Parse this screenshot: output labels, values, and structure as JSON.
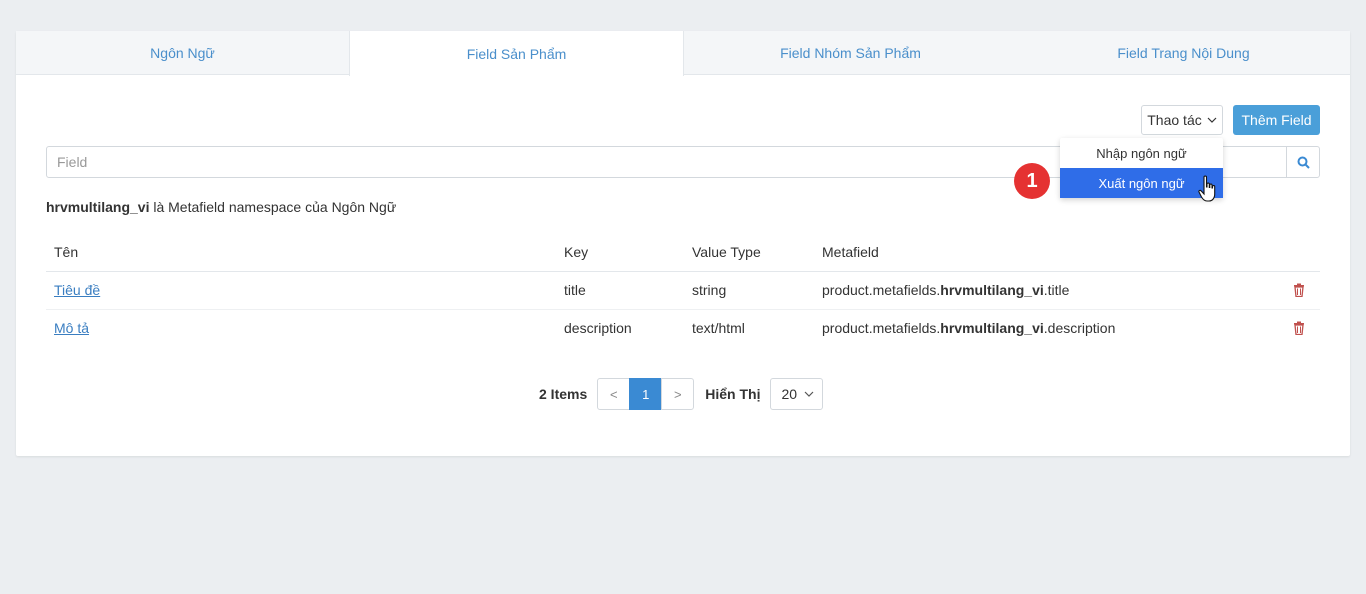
{
  "tabs": [
    {
      "label": "Ngôn Ngữ",
      "active": false
    },
    {
      "label": "Field Sản Phẩm",
      "active": true
    },
    {
      "label": "Field Nhóm Sản Phẩm",
      "active": false
    },
    {
      "label": "Field Trang Nội Dung",
      "active": false
    }
  ],
  "toolbar": {
    "actions_label": "Thao tác",
    "add_label": "Thêm Field"
  },
  "search": {
    "placeholder": "Field",
    "value": ""
  },
  "note": {
    "namespace": "hrvmultilang_vi",
    "text": " là Metafield namespace của Ngôn Ngữ"
  },
  "table": {
    "headers": [
      "Tên",
      "Key",
      "Value Type",
      "Metafield"
    ],
    "rows": [
      {
        "name": "Tiêu đề",
        "key": "title",
        "type": "string",
        "meta_prefix": "product.metafields.",
        "meta_ns": "hrvmultilang_vi",
        "meta_suffix": ".title"
      },
      {
        "name": "Mô tả",
        "key": "description",
        "type": "text/html",
        "meta_prefix": "product.metafields.",
        "meta_ns": "hrvmultilang_vi",
        "meta_suffix": ".description"
      }
    ]
  },
  "pagination": {
    "items_label": "2 Items",
    "prev": "<",
    "current": "1",
    "next": ">",
    "show_label": "Hiển Thị",
    "per_page": "20"
  },
  "dropdown": {
    "items": [
      {
        "label": "Nhập ngôn ngữ",
        "active": false
      },
      {
        "label": "Xuất ngôn ngữ",
        "active": true
      }
    ]
  },
  "annotation": {
    "step": "1"
  },
  "colors": {
    "primary": "#4a9fd9",
    "link": "#3a7ec1",
    "dropdown_active": "#2f6de8",
    "badge": "#e53232",
    "trash": "#c0504d"
  }
}
